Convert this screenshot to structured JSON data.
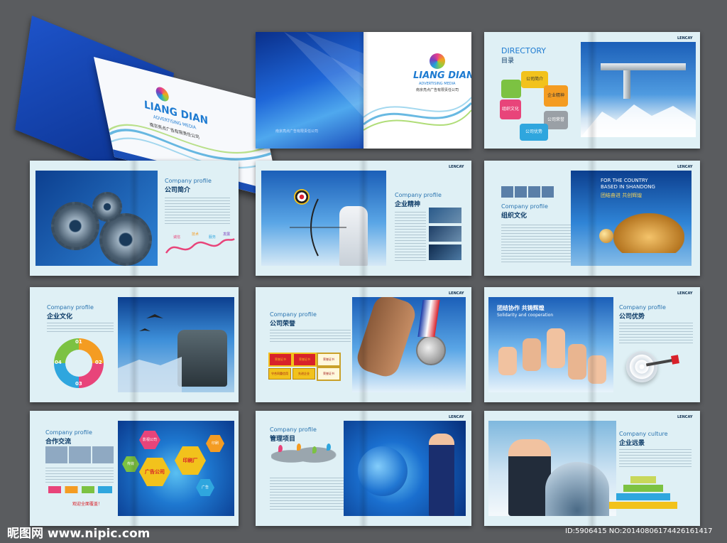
{
  "cover": {
    "brand": "LIANG DIAN",
    "subtitle": "ADVERTISING MEDIA",
    "company_cn": "南京亮点广告有限责任公司"
  },
  "spread2": {
    "brand": "LIANG DIAN",
    "subtitle": "ADVERTISING MEDIA",
    "company_cn": "南京亮点广告有限责任公司"
  },
  "directory": {
    "title_en": "DIRECTORY",
    "title_cn": "目录",
    "items": [
      "公司简介",
      "企业精神",
      "公司荣誉",
      "公司优势",
      "组织文化"
    ]
  },
  "logo_text": "LENCAY",
  "pages": {
    "p1": {
      "en": "Company profile",
      "cn": "公司简介",
      "curve_labels": [
        "诚信",
        "技术",
        "服务",
        "发展"
      ]
    },
    "p2": {
      "en": "Company profile",
      "cn": "企业精神"
    },
    "p3": {
      "en": "Company profile",
      "cn": "组织文化",
      "banner_en1": "FOR THE COUNTRY",
      "banner_en2": "BASED IN SHANDONG",
      "banner_cn": "团结奋进 共创辉煌"
    },
    "p4": {
      "en": "Company profile",
      "cn": "企业文化",
      "cycle": [
        "01",
        "02",
        "03",
        "04"
      ]
    },
    "p5": {
      "en": "Company profile",
      "cn": "公司荣誉",
      "certs": [
        "荣誉证书",
        "荣誉证书",
        "荣誉证书",
        "荣誉证书",
        "守合同重信用",
        "先进企业"
      ]
    },
    "p6": {
      "en": "Company profile",
      "cn": "公司优势",
      "banner_cn": "团结协作 共铸辉煌",
      "banner_en": "Solidarity and cooperation"
    },
    "p7": {
      "en": "Company profile",
      "cn": "合作交流",
      "footer": "观迎全面覆盖！",
      "hexes": [
        "广告公司",
        "印刷厂",
        "影视公司",
        "印刷",
        "传媒",
        "广告"
      ]
    },
    "p8": {
      "en": "Company profile",
      "cn": "管理项目"
    },
    "p9": {
      "en": "Company culture",
      "cn": "企业远景"
    }
  },
  "watermark_left": "昵图网 www.nipic.com",
  "watermark_right": "ID:5906415 NO:20140806174426161417",
  "colors": {
    "accent": "#0d5f9c",
    "blue_dark": "#0a2f8a",
    "page_bg": "#dff0f5",
    "background": "#5a5c5f"
  }
}
